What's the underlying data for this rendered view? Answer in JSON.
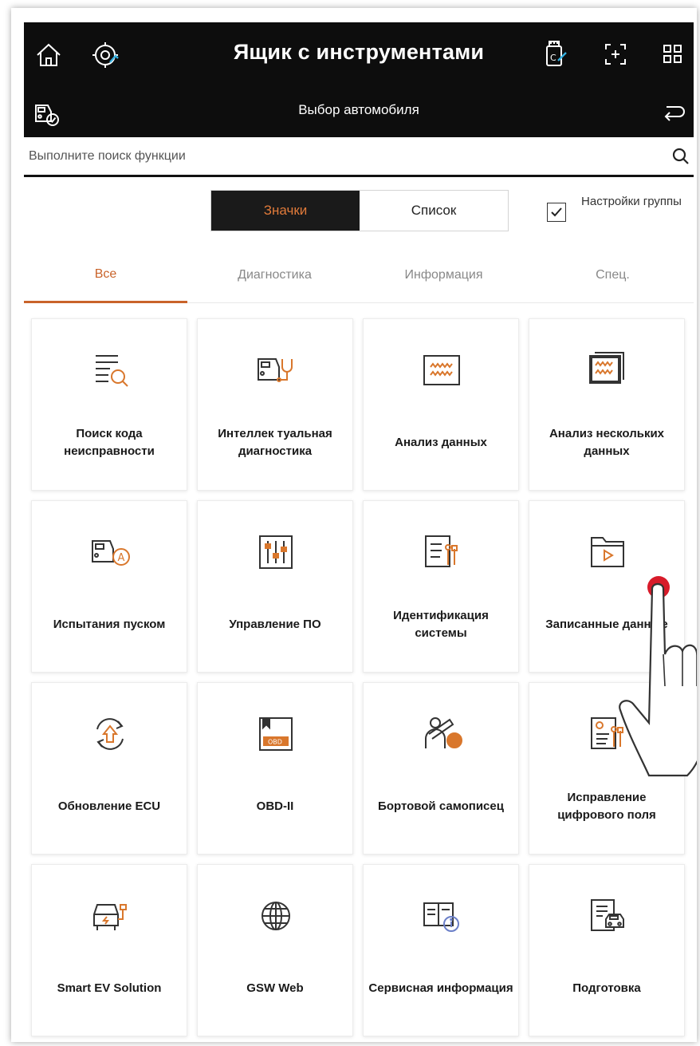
{
  "header": {
    "title": "Ящик с инструментами",
    "subtitle": "Выбор автомобиля"
  },
  "search": {
    "placeholder": "Выполните поиск функции"
  },
  "view_toggle": {
    "icons_label": "Значки",
    "list_label": "Список",
    "selected": "Значки"
  },
  "group_settings": {
    "label": "Настройки группы",
    "checked": true
  },
  "tabs": [
    {
      "label": "Все",
      "active": true
    },
    {
      "label": "Диагностика",
      "active": false
    },
    {
      "label": "Информация",
      "active": false
    },
    {
      "label": "Спец.",
      "active": false
    }
  ],
  "tiles": [
    {
      "label": "Поиск кода неисправности",
      "icon": "dtc-search-icon"
    },
    {
      "label": "Интеллек туальная диагностика",
      "icon": "car-stethoscope-icon"
    },
    {
      "label": "Анализ данных",
      "icon": "data-analysis-icon"
    },
    {
      "label": "Анализ нескольких данных",
      "icon": "multi-data-analysis-icon"
    },
    {
      "label": "Испытания пуском",
      "icon": "car-actuation-icon"
    },
    {
      "label": "Управление ПО",
      "icon": "sliders-icon"
    },
    {
      "label": "Идентификация системы",
      "icon": "system-id-icon"
    },
    {
      "label": "Записанные данные",
      "icon": "recorded-folder-icon"
    },
    {
      "label": "Обновление ECU",
      "icon": "ecu-update-icon"
    },
    {
      "label": "OBD-II",
      "icon": "obd-icon"
    },
    {
      "label": "Бортовой самописец",
      "icon": "onboard-recorder-icon"
    },
    {
      "label": "Исправление цифрового поля",
      "icon": "field-fix-icon"
    },
    {
      "label": "Smart EV Solution",
      "icon": "ev-car-icon"
    },
    {
      "label": "GSW Web",
      "icon": "globe-icon"
    },
    {
      "label": "Сервисная информация",
      "icon": "service-book-icon"
    },
    {
      "label": "Подготовка",
      "icon": "preparation-icon"
    }
  ],
  "colors": {
    "accent": "#c9632a",
    "header_bg": "#0d0d0d"
  }
}
